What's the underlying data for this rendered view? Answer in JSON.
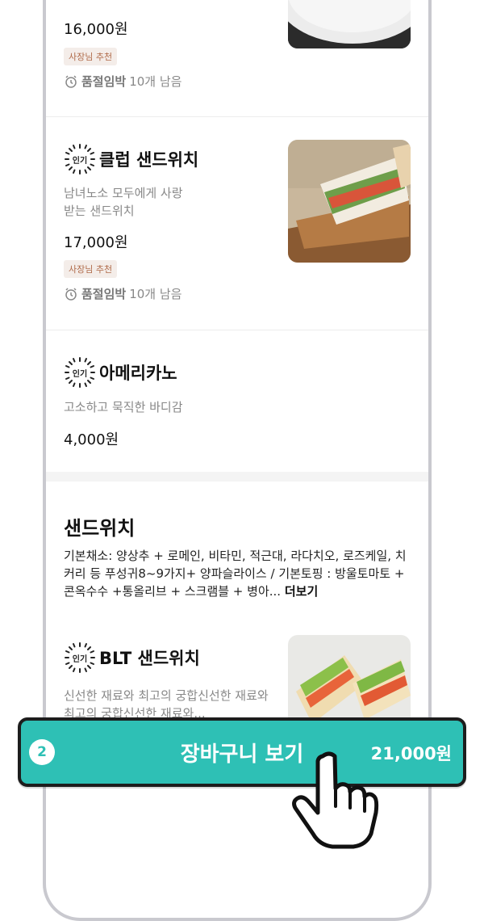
{
  "menu_items": [
    {
      "name": "",
      "price": "16,000원",
      "tag": "사장님 추천",
      "stock_bold": "품절임박",
      "stock_text": "10개 남음"
    },
    {
      "badge": "인기",
      "name": "클럽 샌드위치",
      "description": "남녀노소 모두에게 사랑받는 샌드위치",
      "price": "17,000원",
      "tag": "사장님 추천",
      "stock_bold": "품절임박",
      "stock_text": "10개 남음"
    },
    {
      "badge": "인기",
      "name": "아메리카노",
      "description": "고소하고 묵직한 바디감",
      "price": "4,000원"
    }
  ],
  "section": {
    "title": "샌드위치",
    "description": "기본채소: 양상추 + 로메인, 비타민, 적근대, 라다치오, 로즈케일, 치커리 등 푸성귀8~9가지+ 양파슬라이스 / 기본토핑 : 방울토마토 + 콘옥수수 +통올리브 + 스크램블 + 병아...",
    "more": "더보기"
  },
  "blt": {
    "badge": "인기",
    "name": "BLT 샌드위치",
    "description": "신선한 재료와 최고의 궁합신선한 재료와 최고의 궁합신선한 재료와..."
  },
  "cart": {
    "count": "2",
    "label": "장바구니 보기",
    "total": "21,000원"
  },
  "colors": {
    "accent": "#2ec0b5",
    "tag_bg": "#f4ede9",
    "tag_text": "#b06b4a"
  }
}
